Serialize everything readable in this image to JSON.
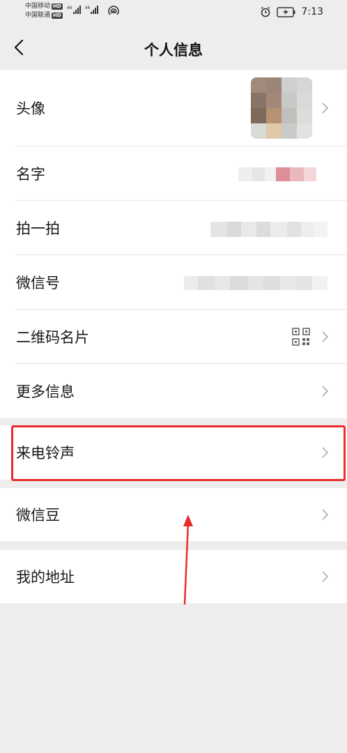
{
  "status": {
    "carrier1": "中国移动",
    "carrier2": "中国联通",
    "hd": "HD",
    "net1": "46",
    "net2": "46",
    "time": "7:13"
  },
  "nav": {
    "title": "个人信息"
  },
  "rows": {
    "avatar": "头像",
    "name": "名字",
    "pat": "拍一拍",
    "wechat_id": "微信号",
    "qr_card": "二维码名片",
    "more_info": "更多信息",
    "ringtone": "来电铃声",
    "wechat_beans": "微信豆",
    "address": "我的地址"
  },
  "colors": {
    "highlight": "#ea2b2b",
    "background": "#ededed"
  }
}
